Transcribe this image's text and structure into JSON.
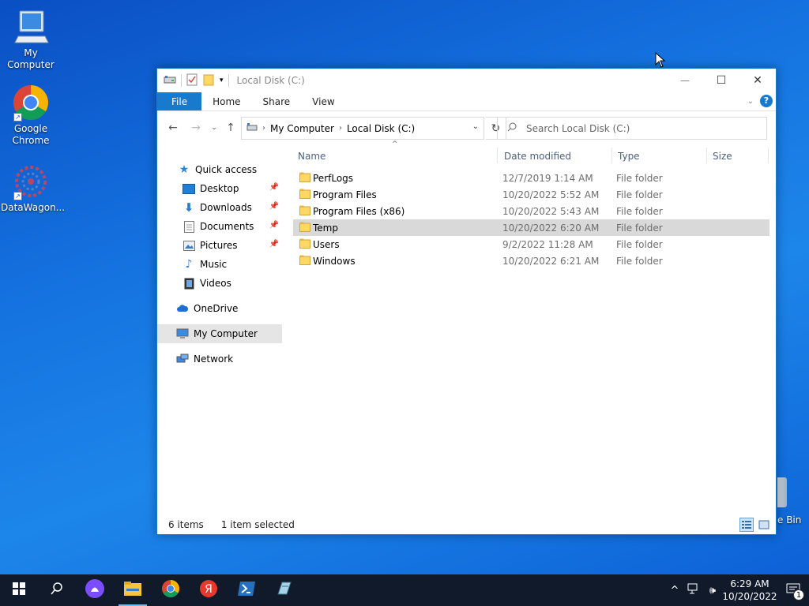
{
  "desktop": {
    "icons": [
      {
        "label": "My Computer"
      },
      {
        "label": "Google Chrome"
      },
      {
        "label": "DataWagon..."
      }
    ],
    "recycle_bin_partial_label": "e Bin"
  },
  "window": {
    "title": "Local Disk (C:)",
    "controls": {
      "minimize": "—",
      "maximize": "☐",
      "close": "✕"
    },
    "ribbon_tabs": [
      "File",
      "Home",
      "Share",
      "View"
    ],
    "help": "?",
    "address": {
      "crumbs": [
        "My Computer",
        "Local Disk (C:)"
      ]
    },
    "search": {
      "placeholder": "Search Local Disk (C:)"
    },
    "nav_pane": {
      "quick_access": "Quick access",
      "items": [
        {
          "label": "Desktop",
          "pinned": true
        },
        {
          "label": "Downloads",
          "pinned": true
        },
        {
          "label": "Documents",
          "pinned": true
        },
        {
          "label": "Pictures",
          "pinned": true
        },
        {
          "label": "Music",
          "pinned": false
        },
        {
          "label": "Videos",
          "pinned": false
        }
      ],
      "onedrive": "OneDrive",
      "my_computer": "My Computer",
      "network": "Network"
    },
    "columns": {
      "name": "Name",
      "date": "Date modified",
      "type": "Type",
      "size": "Size"
    },
    "rows": [
      {
        "name": "PerfLogs",
        "date": "12/7/2019 1:14 AM",
        "type": "File folder",
        "selected": false
      },
      {
        "name": "Program Files",
        "date": "10/20/2022 5:52 AM",
        "type": "File folder",
        "selected": false
      },
      {
        "name": "Program Files (x86)",
        "date": "10/20/2022 5:43 AM",
        "type": "File folder",
        "selected": false
      },
      {
        "name": "Temp",
        "date": "10/20/2022 6:20 AM",
        "type": "File folder",
        "selected": true
      },
      {
        "name": "Users",
        "date": "9/2/2022 11:28 AM",
        "type": "File folder",
        "selected": false
      },
      {
        "name": "Windows",
        "date": "10/20/2022 6:21 AM",
        "type": "File folder",
        "selected": false
      }
    ],
    "status": {
      "count": "6 items",
      "selected": "1 item selected"
    }
  },
  "taskbar": {
    "apps": [
      "start-icon",
      "search-icon",
      "alice-icon",
      "file-explorer-icon",
      "chrome-icon",
      "yandex-icon",
      "powershell-icon",
      "app-icon"
    ],
    "clock_time": "6:29 AM",
    "clock_date": "10/20/2022",
    "notification_count": "1"
  },
  "colors": {
    "accent": "#1979ca",
    "selected_row": "#d9d9d9",
    "taskbar": "#111a2a"
  }
}
